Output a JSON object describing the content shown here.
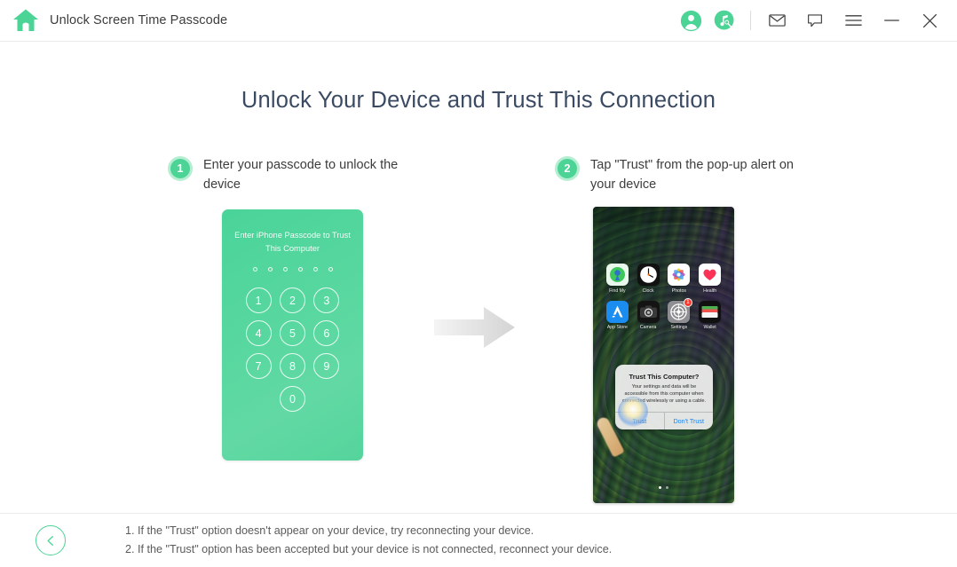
{
  "titlebar": {
    "home_icon": "home-icon",
    "title": "Unlock Screen Time Passcode",
    "account_icon": "account-icon",
    "music_tool_icon": "music-tool-icon",
    "mail_icon": "mail-icon",
    "feedback_icon": "feedback-icon",
    "menu_icon": "hamburger-menu-icon",
    "minimize_icon": "minimize-icon",
    "close_icon": "close-icon"
  },
  "page": {
    "title": "Unlock Your Device and Trust This Connection"
  },
  "steps": [
    {
      "number": "1",
      "text": "Enter your passcode to unlock the device"
    },
    {
      "number": "2",
      "text": "Tap \"Trust\" from the pop-up alert on your device"
    }
  ],
  "passcode_screen": {
    "prompt": "Enter iPhone Passcode to Trust This Computer",
    "dot_count": 6,
    "keys": [
      "1",
      "2",
      "3",
      "4",
      "5",
      "6",
      "7",
      "8",
      "9",
      "0"
    ]
  },
  "arrow": {
    "icon": "right-arrow-icon"
  },
  "home_screen": {
    "apps": [
      {
        "name": "Find My",
        "icon": "find-my-icon",
        "badge": ""
      },
      {
        "name": "Clock",
        "icon": "clock-icon",
        "badge": ""
      },
      {
        "name": "Photos",
        "icon": "photos-icon",
        "badge": ""
      },
      {
        "name": "Health",
        "icon": "health-icon",
        "badge": ""
      },
      {
        "name": "App Store",
        "icon": "app-store-icon",
        "badge": ""
      },
      {
        "name": "Camera",
        "icon": "camera-icon",
        "badge": ""
      },
      {
        "name": "Settings",
        "icon": "settings-icon",
        "badge": "1"
      },
      {
        "name": "Wallet",
        "icon": "wallet-icon",
        "badge": ""
      }
    ],
    "dialog": {
      "title": "Trust This Computer?",
      "body": "Your settings and data will be accessible from this computer when connected wirelessly or using a cable.",
      "trust_label": "Trust",
      "dont_trust_label": "Don't Trust"
    }
  },
  "footer": {
    "back_icon": "back-arrow-icon",
    "notes": [
      "1. If the \"Trust\" option doesn't appear on your device, try reconnecting your device.",
      "2. If the \"Trust\" option has been accepted but your device is not connected, reconnect your device."
    ]
  },
  "colors": {
    "accent_green": "#4cd396",
    "title_navy": "#3a4a63",
    "badge_red": "#f63a2e",
    "ios_blue": "#1782f0"
  }
}
